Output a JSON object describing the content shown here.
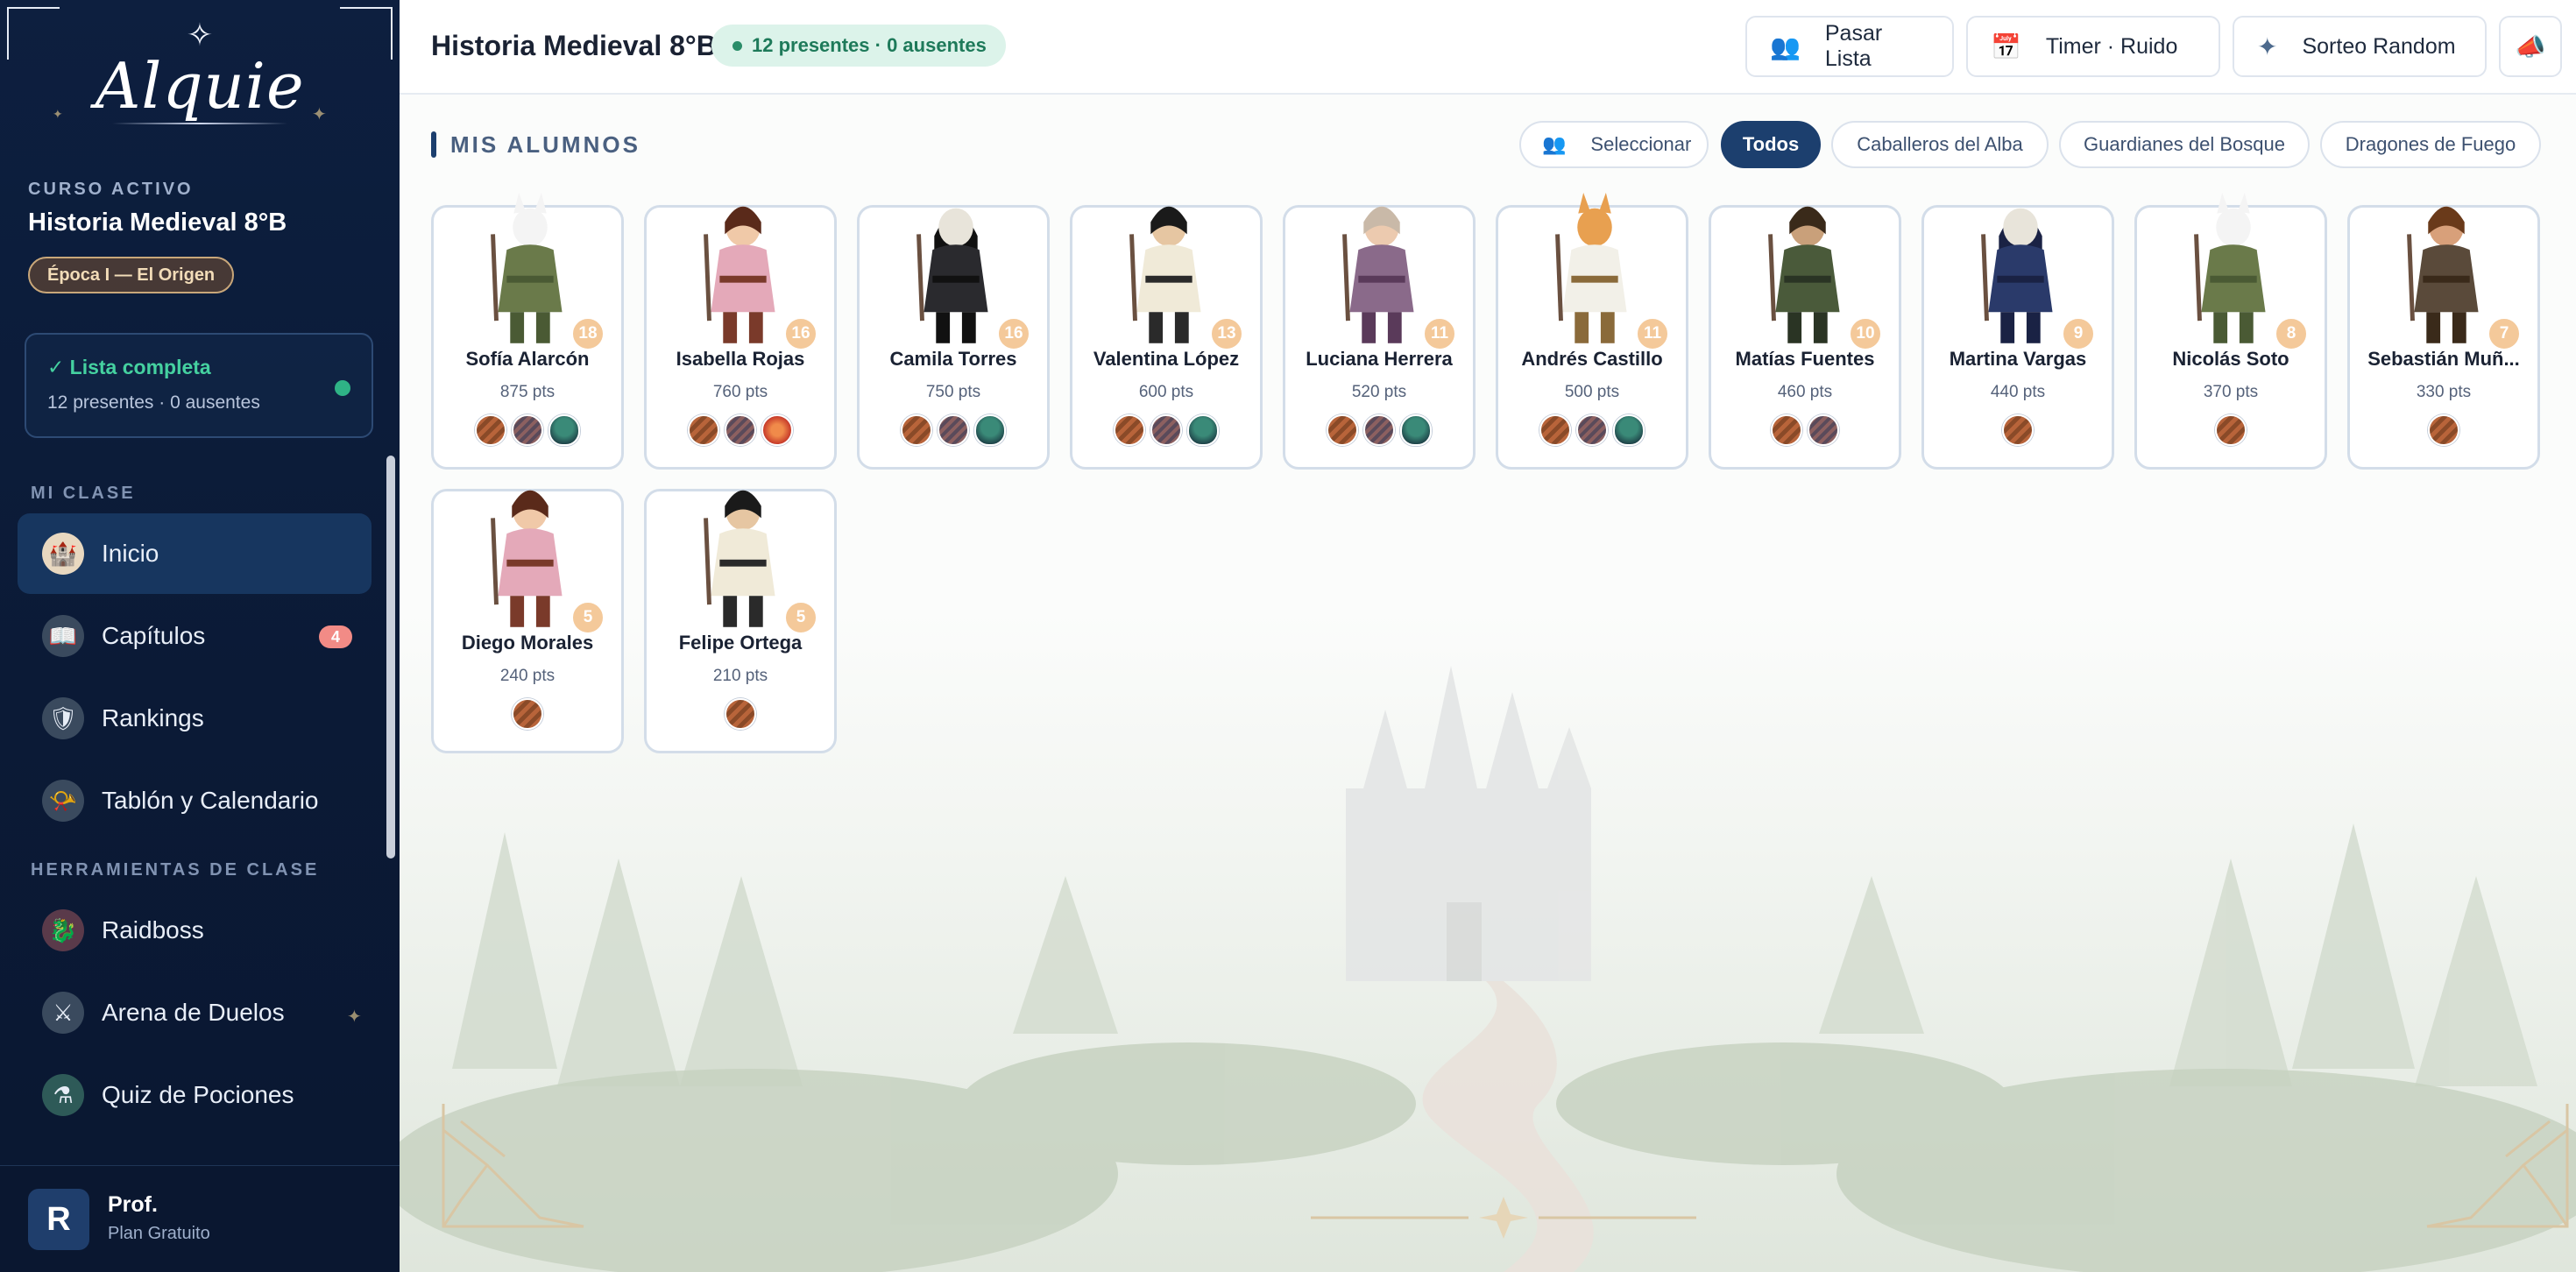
{
  "brand": {
    "name": "Alquie"
  },
  "course": {
    "caption": "CURSO ACTIVO",
    "name": "Historia Medieval 8°B",
    "epoch": "Época I — El Origen"
  },
  "attendance": {
    "title": "✓ Lista completa",
    "summary": "12 presentes · 0 ausentes"
  },
  "sections": {
    "my_class": "MI CLASE",
    "tools": "HERRAMIENTAS DE CLASE"
  },
  "nav": {
    "inicio": "Inicio",
    "capitulos": "Capítulos",
    "capitulos_count": "4",
    "rankings": "Rankings",
    "tablon": "Tablón y Calendario",
    "raidboss": "Raidboss",
    "arena": "Arena de Duelos",
    "quiz": "Quiz de Pociones"
  },
  "profile": {
    "initial": "R",
    "name": "Prof.",
    "plan": "Plan Gratuito"
  },
  "header": {
    "title": "Historia Medieval 8°B",
    "presence": "12 presentes · 0 ausentes",
    "buttons": {
      "roll_call": "Pasar Lista",
      "timer": "Timer · Ruido",
      "random": "Sorteo Random"
    }
  },
  "students_section": {
    "title": "MIS ALUMNOS",
    "select_label": "Seleccionar",
    "filters": [
      "Todos",
      "Caballeros del Alba",
      "Guardianes del Bosque",
      "Dragones de Fuego"
    ],
    "active_filter": "Todos"
  },
  "students": [
    {
      "name": "Sofía Alarcón",
      "points": "875 pts",
      "level": "18",
      "char": "cat",
      "badges": [
        "wood",
        "steel",
        "shield"
      ]
    },
    {
      "name": "Isabella Rojas",
      "points": "760 pts",
      "level": "16",
      "char": "bard",
      "badges": [
        "wood",
        "steel",
        "fire"
      ]
    },
    {
      "name": "Camila Torres",
      "points": "750 pts",
      "level": "16",
      "char": "reaper",
      "badges": [
        "wood",
        "steel",
        "shield"
      ]
    },
    {
      "name": "Valentina López",
      "points": "600 pts",
      "level": "13",
      "char": "samurai",
      "badges": [
        "wood",
        "steel",
        "shield"
      ]
    },
    {
      "name": "Luciana Herrera",
      "points": "520 pts",
      "level": "11",
      "char": "elf",
      "badges": [
        "wood",
        "steel",
        "shield"
      ]
    },
    {
      "name": "Andrés Castillo",
      "points": "500 pts",
      "level": "11",
      "char": "fox",
      "badges": [
        "wood",
        "steel",
        "shield"
      ]
    },
    {
      "name": "Matías Fuentes",
      "points": "460 pts",
      "level": "10",
      "char": "ranger",
      "badges": [
        "wood",
        "steel"
      ]
    },
    {
      "name": "Martina Vargas",
      "points": "440 pts",
      "level": "9",
      "char": "mage",
      "badges": [
        "wood"
      ]
    },
    {
      "name": "Nicolás Soto",
      "points": "370 pts",
      "level": "8",
      "char": "cat",
      "badges": [
        "wood"
      ]
    },
    {
      "name": "Sebastián Muñ...",
      "points": "330 pts",
      "level": "7",
      "char": "dwarf",
      "badges": [
        "wood"
      ]
    },
    {
      "name": "Diego Morales",
      "points": "240 pts",
      "level": "5",
      "char": "bard",
      "badges": [
        "wood"
      ]
    },
    {
      "name": "Felipe Ortega",
      "points": "210 pts",
      "level": "5",
      "char": "samurai",
      "badges": [
        "wood"
      ]
    }
  ]
}
